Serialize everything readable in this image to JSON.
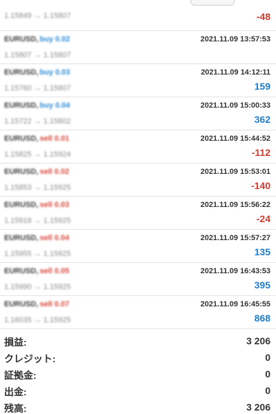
{
  "top_partial": {
    "prices": "1.15849 → 1.15807",
    "profit": "-48"
  },
  "deals": [
    {
      "symbol": "EURUSD,",
      "direction": "buy 0.02",
      "side": "buy",
      "prices": "1.15807 → 1.15807",
      "time": "2021.11.09 13:57:53",
      "profit": "",
      "sign": "pos"
    },
    {
      "symbol": "EURUSD,",
      "direction": "buy 0.03",
      "side": "buy",
      "prices": "1.15760 → 1.15807",
      "time": "2021.11.09 14:12:11",
      "profit": "159",
      "sign": "pos"
    },
    {
      "symbol": "EURUSD,",
      "direction": "buy 0.04",
      "side": "buy",
      "prices": "1.15722 → 1.15802",
      "time": "2021.11.09 15:00:33",
      "profit": "362",
      "sign": "pos"
    },
    {
      "symbol": "EURUSD,",
      "direction": "sell 0.01",
      "side": "sell",
      "prices": "1.15825 → 1.15924",
      "time": "2021.11.09 15:44:52",
      "profit": "-112",
      "sign": "neg"
    },
    {
      "symbol": "EURUSD,",
      "direction": "sell 0.02",
      "side": "sell",
      "prices": "1.15853 → 1.15925",
      "time": "2021.11.09 15:53:01",
      "profit": "-140",
      "sign": "neg"
    },
    {
      "symbol": "EURUSD,",
      "direction": "sell 0.03",
      "side": "sell",
      "prices": "1.15918 → 1.15925",
      "time": "2021.11.09 15:56:22",
      "profit": "-24",
      "sign": "neg"
    },
    {
      "symbol": "EURUSD,",
      "direction": "sell 0.04",
      "side": "sell",
      "prices": "1.15955 → 1.15925",
      "time": "2021.11.09 15:57:27",
      "profit": "135",
      "sign": "pos"
    },
    {
      "symbol": "EURUSD,",
      "direction": "sell 0.05",
      "side": "sell",
      "prices": "1.15990 → 1.15925",
      "time": "2021.11.09 16:43:53",
      "profit": "395",
      "sign": "pos"
    },
    {
      "symbol": "EURUSD,",
      "direction": "sell 0.07",
      "side": "sell",
      "prices": "1.16035 → 1.15925",
      "time": "2021.11.09 16:45:55",
      "profit": "868",
      "sign": "pos"
    }
  ],
  "summary": [
    {
      "label": "損益:",
      "value": "3 206"
    },
    {
      "label": "クレジット:",
      "value": "0"
    },
    {
      "label": "証拠金:",
      "value": "0"
    },
    {
      "label": "出金:",
      "value": "0"
    },
    {
      "label": "残高:",
      "value": "3 206"
    }
  ],
  "colors": {
    "positive": "#1f7ccd",
    "negative": "#d23a2e",
    "buy": "#2a8bd6",
    "sell": "#d9473b"
  }
}
